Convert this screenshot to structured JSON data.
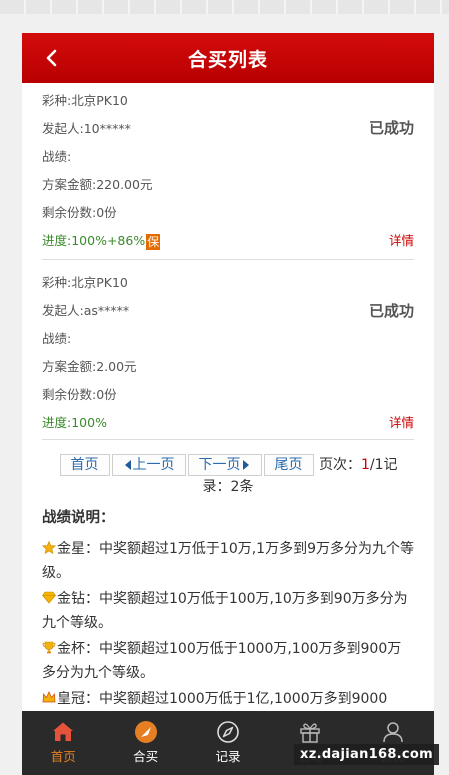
{
  "header": {
    "title": "合买列表"
  },
  "items": [
    {
      "lottery": "彩种:北京PK10",
      "initiator": "发起人:10*****",
      "status": "已成功",
      "record": "战绩:",
      "amount": "方案金额:220.00元",
      "remaining": "剩余份数:0份",
      "progress": "进度:100%+86%",
      "guarantee_badge": "保",
      "detail": "详情"
    },
    {
      "lottery": "彩种:北京PK10",
      "initiator": "发起人:as*****",
      "status": "已成功",
      "record": "战绩:",
      "amount": "方案金额:2.00元",
      "remaining": "剩余份数:0份",
      "progress": "进度:100%",
      "detail": "详情"
    }
  ],
  "pager": {
    "first": "首页",
    "prev": "上一页",
    "next": "下一页",
    "last": "尾页",
    "page_label": "页次：",
    "current_page": "1",
    "total_pages": "/1",
    "records_a": "记",
    "records_b": "录：2条"
  },
  "notes": {
    "title": "战绩说明：",
    "lines": [
      "金星：中奖额超过1万低于10万,1万多到9万多分为九个等级。",
      "金钻：中奖额超过10万低于100万,10万多到90万多分为九个等级。",
      "金杯：中奖额超过100万低于1000万,100万多到900万多分为九个等级。",
      "皇冠：中奖额超过1000万低于1亿,1000万多到9000"
    ]
  },
  "tabbar": {
    "items": [
      {
        "label": "首页",
        "icon": "home-icon"
      },
      {
        "label": "合买",
        "icon": "group-buy-icon"
      },
      {
        "label": "记录",
        "icon": "compass-icon"
      },
      {
        "label": "活动",
        "icon": "gift-icon"
      },
      {
        "label": "会员",
        "icon": "user-icon"
      }
    ],
    "active_color": "#e67e22"
  },
  "watermark": "xz.dajian168.com",
  "colors": {
    "header": "#c80000",
    "success_progress": "#3a8a2a",
    "detail": "#cc0000"
  }
}
